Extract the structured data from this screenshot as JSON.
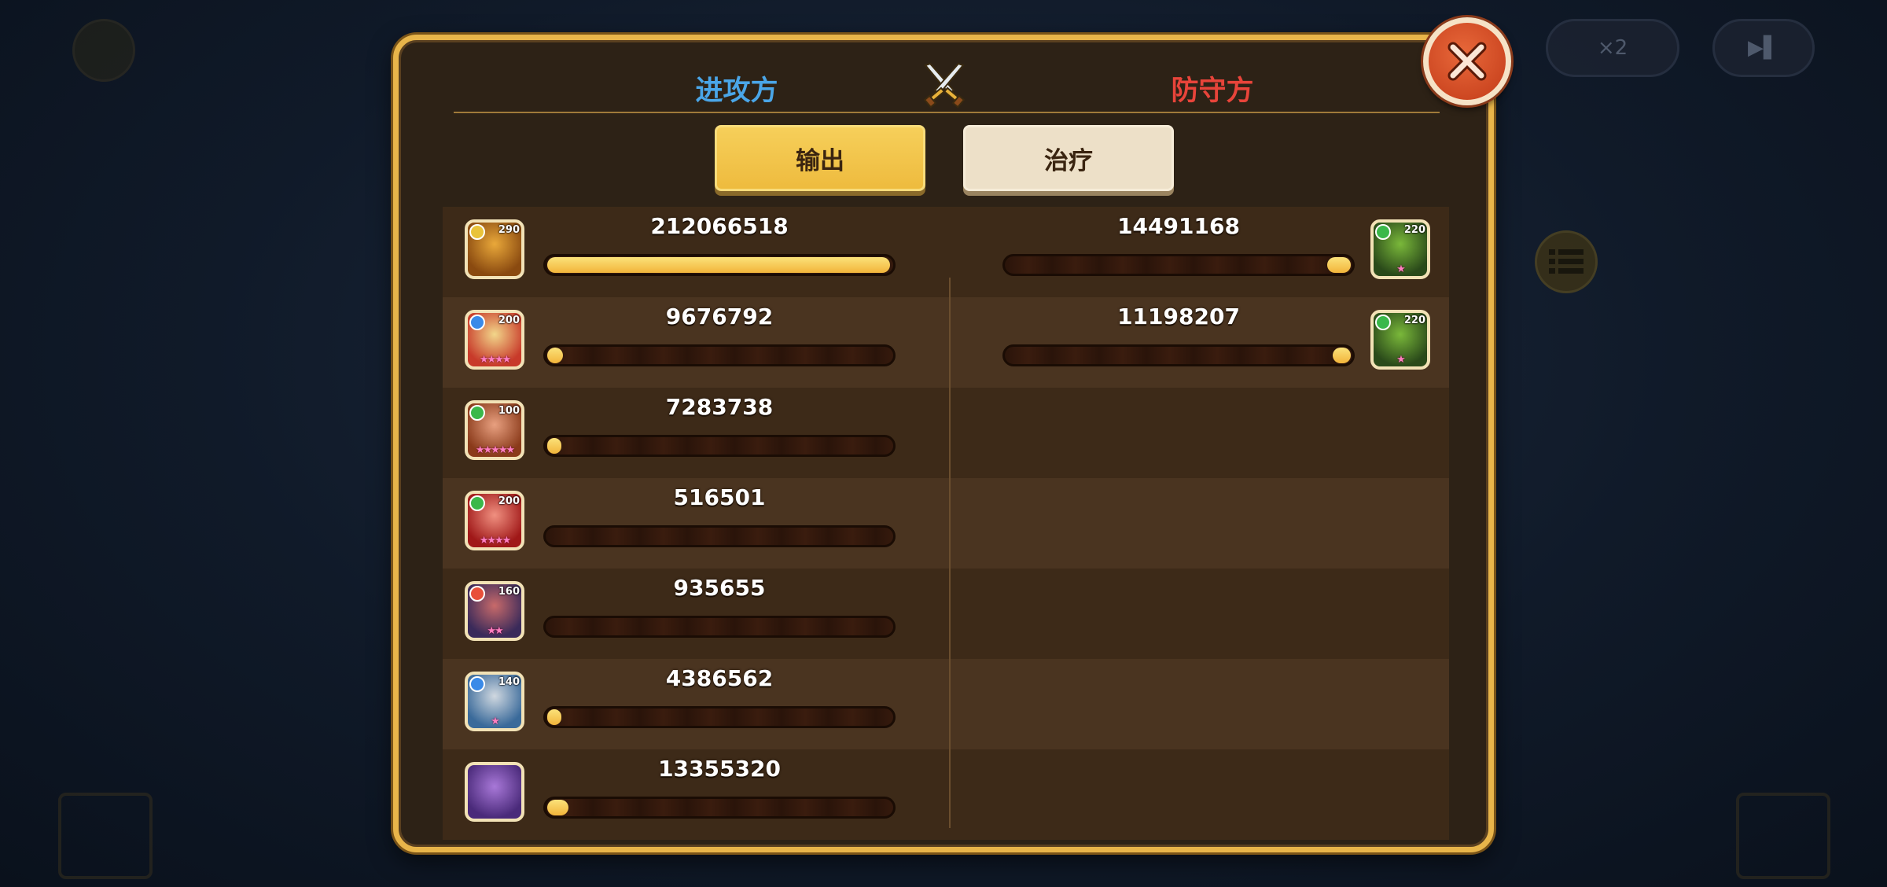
{
  "window": {
    "attacker_label": "进攻方",
    "defender_label": "防守方"
  },
  "tabs": [
    {
      "label": "输出",
      "selected": true
    },
    {
      "label": "治疗",
      "selected": false
    }
  ],
  "background": {
    "speed_label": "×2"
  },
  "colors": {
    "attacker": "#4aa6e8",
    "defender": "#e8443a",
    "panel_border": "#e8b54a",
    "bar_fill": "#f2b43a"
  },
  "attackers": [
    {
      "value": "212066518",
      "fraction": 1.0,
      "level": "290",
      "stars": "",
      "element": "gold",
      "portrait": "golden-knight"
    },
    {
      "value": "9676792",
      "fraction": 0.046,
      "level": "200",
      "stars": "★★★★",
      "element": "blue",
      "portrait": "red-haired-priest"
    },
    {
      "value": "7283738",
      "fraction": 0.034,
      "level": "100",
      "stars": "★★★★★",
      "element": "green",
      "portrait": "elf-warrior"
    },
    {
      "value": "516501",
      "fraction": 0.002,
      "level": "200",
      "stars": "★★★★",
      "element": "green",
      "portrait": "red-haired-elf"
    },
    {
      "value": "935655",
      "fraction": 0.004,
      "level": "160",
      "stars": "★★",
      "element": "red",
      "portrait": "horned-beast"
    },
    {
      "value": "4386562",
      "fraction": 0.021,
      "level": "140",
      "stars": "★",
      "element": "blue",
      "portrait": "armored-knight"
    },
    {
      "value": "13355320",
      "fraction": 0.063,
      "level": "",
      "stars": "",
      "element": "",
      "portrait": "purple-dragon"
    }
  ],
  "defenders": [
    {
      "value": "14491168",
      "fraction": 0.068,
      "level": "220",
      "stars": "★",
      "element": "green",
      "portrait": "green-beast"
    },
    {
      "value": "11198207",
      "fraction": 0.053,
      "level": "220",
      "stars": "★",
      "element": "green",
      "portrait": "green-beast"
    }
  ]
}
